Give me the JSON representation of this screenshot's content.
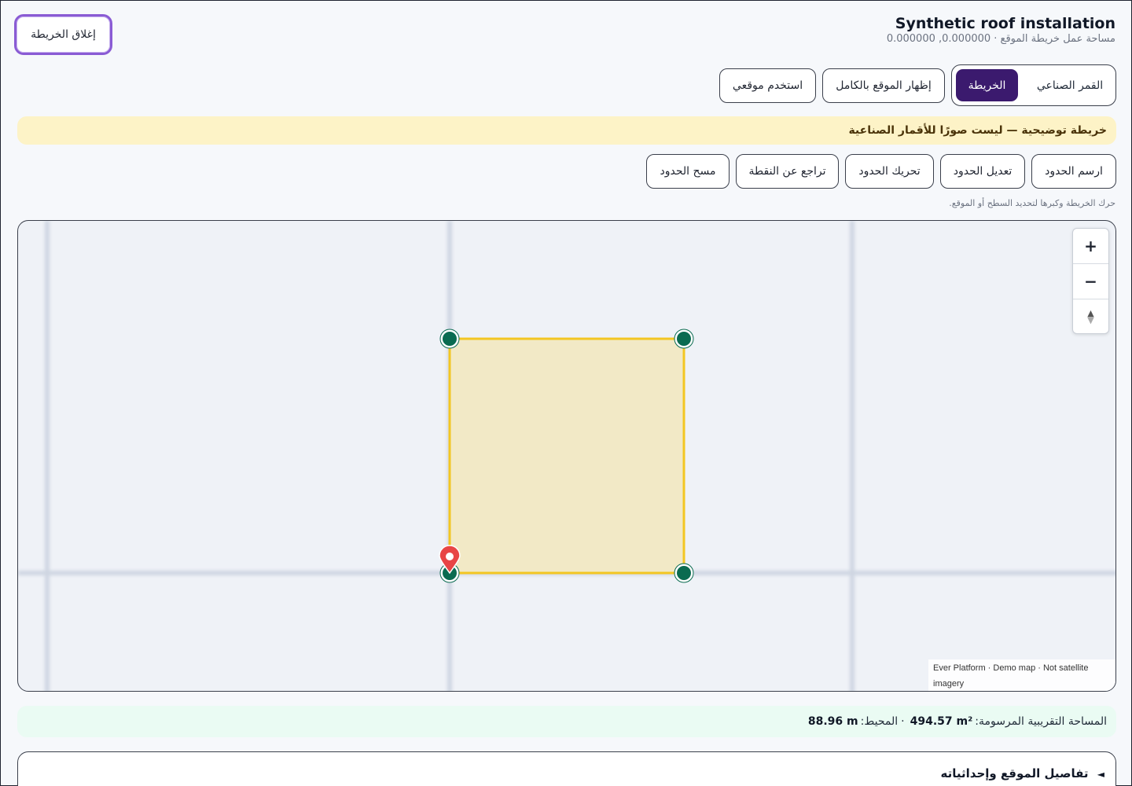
{
  "header": {
    "close_label": "إغلاق الخريطة",
    "title": "Synthetic roof installation",
    "subtitle": "مساحة عمل خريطة الموقع · 0.000000, 0.000000"
  },
  "view_toggle": {
    "items": [
      {
        "label": "القمر الصناعي",
        "active": false
      },
      {
        "label": "الخريطة",
        "active": true
      }
    ]
  },
  "actions": {
    "show_full_site": "إظهار الموقع بالكامل",
    "use_my_location": "استخدم موقعي"
  },
  "banner": {
    "text": "خريطة توضيحية — ليست صورًا للأقمار الصناعية"
  },
  "tools": {
    "draw": "ارسم الحدود",
    "edit": "تعديل الحدود",
    "move": "تحريك الحدود",
    "undo": "تراجع عن النقطة",
    "clear": "مسح الحدود"
  },
  "hint": "حرك الخريطة وكبرها لتحديد السطح أو الموقع.",
  "map": {
    "zoom_in": "+",
    "zoom_out": "−",
    "compass": "▲",
    "attribution": "Ever Platform · Demo map · Not satellite imagery",
    "colors": {
      "polygon_fill": "#f2e9c6",
      "polygon_stroke": "#f3c623",
      "vertex": "#0a6b50",
      "marker": "#e84545"
    }
  },
  "summary": {
    "area_label": "المساحة التقريبية المرسومة:",
    "area_value": "494.57 m²",
    "separator": "·",
    "perimeter_label": "المحيط:",
    "perimeter_value": "88.96 m"
  },
  "details": {
    "title": "تفاصيل الموقع وإحداثياته",
    "toggle_icon": "◄"
  }
}
